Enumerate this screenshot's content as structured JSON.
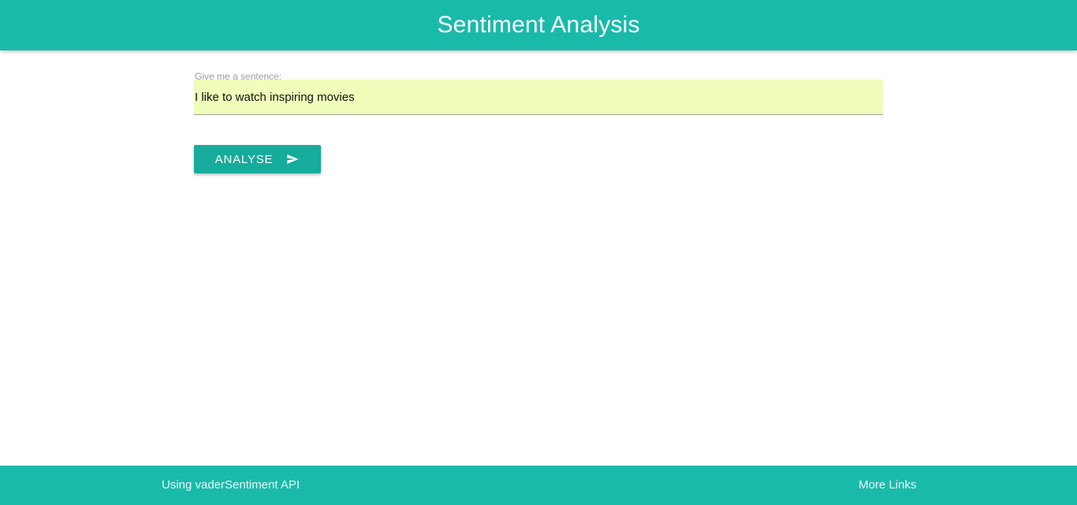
{
  "header": {
    "title": "Sentiment Analysis"
  },
  "form": {
    "label": "Give me a sentence:",
    "input_value": "I like to watch inspiring movies",
    "button_label": "ANALYSE",
    "button_icon": "send-icon"
  },
  "footer": {
    "left_text": "Using vaderSentiment API",
    "right_link": "More Links"
  },
  "colors": {
    "primary": "#1abaaa",
    "button": "#16ab9b",
    "input_bg": "#f0fcb9"
  }
}
